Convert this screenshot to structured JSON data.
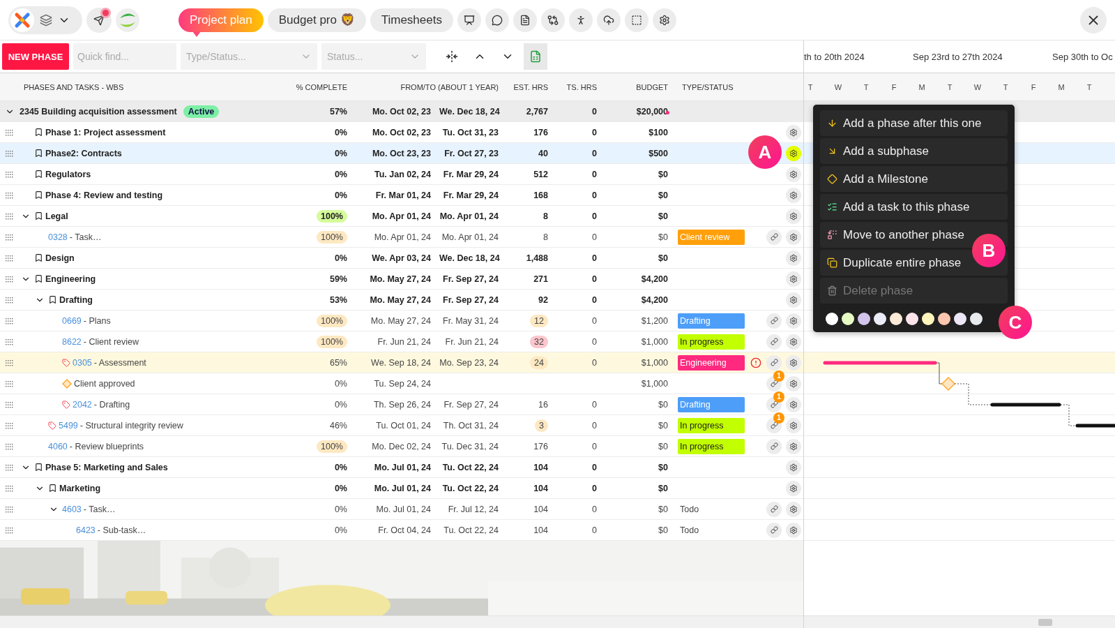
{
  "topbar": {
    "tabs": [
      {
        "label": "Project plan",
        "selected": true
      },
      {
        "label": "Budget pro 🦁",
        "selected": false
      },
      {
        "label": "Timesheets",
        "selected": false
      }
    ],
    "tools": [
      {
        "kind": "presentation"
      },
      {
        "kind": "chat"
      },
      {
        "kind": "file"
      },
      {
        "kind": "compare"
      },
      {
        "kind": "accessibility"
      },
      {
        "kind": "cloud"
      },
      {
        "kind": "select"
      },
      {
        "kind": "settings"
      }
    ],
    "notification": true
  },
  "toolbar": {
    "new_button": "NEW PHASE",
    "search": {
      "placeholder": "Quick find..."
    },
    "type_filter": {
      "placeholder": "Type/Status..."
    },
    "status_filter": {
      "placeholder": "Status..."
    }
  },
  "table": {
    "columns": [
      "PHASES AND TASKS - WBS",
      "% COMPLETE",
      "FROM/TO (ABOUT 1 YEAR)",
      "EST. HRS",
      "TS. HRS",
      "BUDGET",
      "TYPE/STATUS"
    ],
    "rows": [
      {
        "kind": "project",
        "name": "2345 Building acquisition assessment",
        "badge": "Active",
        "expanded": true,
        "selected": false,
        "highlighted": false,
        "percent": "57%",
        "from": "Mo. Oct 02, 23",
        "to": "We. Dec 18, 24",
        "est": "2,767",
        "ts": "0",
        "budget": "$20,000",
        "budget_flag": true,
        "children": [
          {
            "kind": "phase",
            "name": "Phase 1: Project assessment",
            "selected": false,
            "highlighted": false,
            "percent": "0%",
            "from": "Mo. Oct 02, 23",
            "to": "Tu. Oct 31, 23",
            "est": "176",
            "ts": "0",
            "budget": "$100",
            "gear": true,
            "gear_active": false
          },
          {
            "kind": "phase",
            "name": "Phase2: Contracts",
            "selected": true,
            "highlighted": false,
            "percent": "0%",
            "from": "Mo. Oct 23, 23",
            "to": "Fr. Oct 27, 23",
            "est": "40",
            "ts": "0",
            "budget": "$500",
            "gear": true,
            "gear_active": true
          },
          {
            "kind": "phase",
            "name": "Regulators",
            "selected": false,
            "highlighted": false,
            "percent": "0%",
            "from": "Tu. Jan 02, 24",
            "to": "Fr. Mar 29, 24",
            "est": "512",
            "ts": "0",
            "budget": "$0",
            "gear": true,
            "gear_active": false
          },
          {
            "kind": "phase",
            "name": "Phase 4: Review and testing",
            "selected": false,
            "highlighted": false,
            "percent": "0%",
            "from": "Fr. Mar 01, 24",
            "to": "Fr. Mar 29, 24",
            "est": "168",
            "ts": "0",
            "budget": "$0",
            "gear": true,
            "gear_active": false
          },
          {
            "kind": "phase",
            "name": "Legal",
            "expanded": true,
            "selected": false,
            "highlighted": false,
            "percent": "100%",
            "percent_highlight": true,
            "from": "Mo. Apr 01, 24",
            "to": "Mo. Apr 01, 24",
            "est": "8",
            "ts": "0",
            "budget": "$0",
            "gear": true,
            "gear_active": false,
            "children": [
              {
                "kind": "task",
                "code": "0328",
                "name": "- Task…",
                "selected": false,
                "highlighted": false,
                "percent": "100%",
                "percent_highlight": true,
                "from": "Mo. Apr 01, 24",
                "to": "Mo. Apr 01, 24",
                "est": "8",
                "ts": "0",
                "budget": "$0",
                "status": {
                  "label": "Client review",
                  "color": "#ff9f0a"
                },
                "link": true,
                "gear": true,
                "gear_active": false
              }
            ]
          },
          {
            "kind": "phase",
            "name": "Design",
            "selected": false,
            "highlighted": false,
            "percent": "0%",
            "from": "We. Apr 03, 24",
            "to": "We. Dec 18, 24",
            "est": "1,488",
            "ts": "0",
            "budget": "$0",
            "gear": true,
            "gear_active": false
          },
          {
            "kind": "phase",
            "name": "Engineering",
            "expanded": true,
            "selected": false,
            "highlighted": false,
            "percent": "59%",
            "from": "Mo. May 27, 24",
            "to": "Fr. Sep 27, 24",
            "est": "271",
            "ts": "0",
            "budget": "$4,200",
            "gear": true,
            "gear_active": false,
            "children": [
              {
                "kind": "phase",
                "name": "Drafting",
                "expanded": true,
                "selected": false,
                "highlighted": false,
                "percent": "53%",
                "from": "Mo. May 27, 24",
                "to": "Fr. Sep 27, 24",
                "est": "92",
                "ts": "0",
                "budget": "$4,200",
                "gear": true,
                "gear_active": false,
                "children": [
                  {
                    "kind": "task",
                    "code": "0669",
                    "name": "- Plans",
                    "selected": false,
                    "highlighted": false,
                    "percent": "100%",
                    "percent_highlight": true,
                    "from": "Mo. May 27, 24",
                    "to": "Fr. May 31, 24",
                    "est": "12",
                    "est_highlight": true,
                    "est_over": false,
                    "ts": "0",
                    "budget": "$1,200",
                    "status": {
                      "label": "Drafting",
                      "color": "#4d9ef8"
                    },
                    "link": true,
                    "gear": true,
                    "gear_active": false
                  },
                  {
                    "kind": "task",
                    "code": "8622",
                    "name": "- Client review",
                    "selected": false,
                    "highlighted": false,
                    "percent": "100%",
                    "percent_highlight": true,
                    "from": "Fr. Jun 21, 24",
                    "to": "Fr. Jun 21, 24",
                    "est": "32",
                    "est_highlight": true,
                    "est_over": true,
                    "ts": "0",
                    "budget": "$1,000",
                    "status": {
                      "label": "In progress",
                      "color": "#c2ff00"
                    },
                    "link": true,
                    "gear": true,
                    "gear_active": false
                  },
                  {
                    "kind": "task",
                    "tag": true,
                    "code": "0305",
                    "name": "- Assessment",
                    "selected": false,
                    "highlighted": true,
                    "percent": "65%",
                    "from": "We. Sep 18, 24",
                    "to": "Mo. Sep 23, 24",
                    "est": "24",
                    "est_highlight": true,
                    "est_over": false,
                    "ts": "0",
                    "budget": "$1,000",
                    "status": {
                      "label": "Engineering",
                      "color": "#ff2a7f"
                    },
                    "warning": true,
                    "link": true,
                    "gear": true,
                    "gear_active": false
                  },
                  {
                    "kind": "milestone",
                    "name": "Client approved",
                    "selected": false,
                    "highlighted": false,
                    "percent": "0%",
                    "from": "Tu. Sep 24, 24",
                    "budget": "$1,000",
                    "link": true,
                    "link_count": "1",
                    "gear": true,
                    "gear_active": false
                  },
                  {
                    "kind": "task",
                    "tag": true,
                    "code": "2042",
                    "name": "- Drafting",
                    "selected": false,
                    "highlighted": false,
                    "percent": "0%",
                    "from": "Th. Sep 26, 24",
                    "to": "Fr. Sep 27, 24",
                    "est": "16",
                    "ts": "0",
                    "budget": "$0",
                    "status": {
                      "label": "Drafting",
                      "color": "#4d9ef8"
                    },
                    "link": true,
                    "link_count": "1",
                    "gear": true,
                    "gear_active": false
                  }
                ]
              },
              {
                "kind": "task",
                "tag": true,
                "code": "5499",
                "name": "- Structural integrity review",
                "selected": false,
                "highlighted": false,
                "percent": "46%",
                "from": "Tu. Oct 01, 24",
                "to": "Th. Oct 31, 24",
                "est": "3",
                "est_highlight": true,
                "est_over": false,
                "ts": "0",
                "budget": "$0",
                "status": {
                  "label": "In progress",
                  "color": "#c2ff00"
                },
                "link": true,
                "link_count": "1",
                "gear": true,
                "gear_active": false
              },
              {
                "kind": "task",
                "code": "4060",
                "name": "- Review blueprints",
                "selected": false,
                "highlighted": false,
                "percent": "100%",
                "percent_highlight": true,
                "from": "Mo. Dec 02, 24",
                "to": "Tu. Dec 31, 24",
                "est": "176",
                "ts": "0",
                "budget": "$0",
                "status": {
                  "label": "In progress",
                  "color": "#c2ff00"
                },
                "link": true,
                "gear": true,
                "gear_active": false
              }
            ]
          },
          {
            "kind": "phase",
            "name": "Phase 5: Marketing and Sales",
            "expanded": true,
            "selected": false,
            "highlighted": false,
            "percent": "0%",
            "from": "Mo. Jul 01, 24",
            "to": "Tu. Oct 22, 24",
            "est": "104",
            "ts": "0",
            "budget": "$0",
            "gear": true,
            "gear_active": false,
            "children": [
              {
                "kind": "phase",
                "name": "Marketing",
                "expanded": true,
                "selected": false,
                "highlighted": false,
                "percent": "0%",
                "from": "Mo. Jul 01, 24",
                "to": "Tu. Oct 22, 24",
                "est": "104",
                "ts": "0",
                "budget": "$0",
                "gear": true,
                "gear_active": false,
                "children": [
                  {
                    "kind": "task",
                    "code": "4603",
                    "name": "- Task…",
                    "expanded": true,
                    "selected": false,
                    "highlighted": false,
                    "percent": "0%",
                    "from": "Mo. Jul 01, 24",
                    "to": "Fr. Jul 12, 24",
                    "est": "104",
                    "ts": "0",
                    "budget": "$0",
                    "status_text": "Todo",
                    "link": true,
                    "gear": true,
                    "gear_active": false,
                    "children": [
                      {
                        "kind": "task",
                        "code": "6423",
                        "name": "- Sub-task…",
                        "selected": false,
                        "highlighted": false,
                        "percent": "0%",
                        "from": "Fr. Oct 04, 24",
                        "to": "Tu. Oct 22, 24",
                        "est": "104",
                        "ts": "0",
                        "budget": "$0",
                        "status_text": "Todo",
                        "link": true,
                        "gear": true,
                        "gear_active": false
                      }
                    ]
                  }
                ]
              }
            ]
          }
        ]
      }
    ]
  },
  "gantt": {
    "weeks": [
      "th to 20th 2024",
      "Sep 23rd to 27th 2024",
      "Sep 30th to Oc"
    ],
    "days": [
      "T",
      "W",
      "T",
      "F",
      "M",
      "T",
      "W",
      "T",
      "F",
      "M",
      "T"
    ]
  },
  "menu": {
    "items": [
      {
        "kind": "after",
        "label": "Add a phase after this one",
        "disabled": false
      },
      {
        "kind": "subphase",
        "label": "Add a subphase",
        "disabled": false
      },
      {
        "kind": "milestone",
        "label": "Add a Milestone",
        "disabled": false
      },
      {
        "kind": "task",
        "label": "Add a task to this phase",
        "disabled": false
      },
      {
        "kind": "move",
        "label": "Move to another phase",
        "disabled": false
      },
      {
        "kind": "duplicate",
        "label": "Duplicate entire phase",
        "disabled": false
      },
      {
        "kind": "delete",
        "label": "Delete phase",
        "disabled": true
      }
    ],
    "swatches": [
      {
        "color": "#ffffff"
      },
      {
        "color": "#e6fbc4"
      },
      {
        "color": "#d2c4ec"
      },
      {
        "color": "#ecebf8"
      },
      {
        "color": "#fdebd8"
      },
      {
        "color": "#fde4ea"
      },
      {
        "color": "#fdf5bc"
      },
      {
        "color": "#fcc6b0"
      },
      {
        "color": "#ece6f6"
      },
      {
        "color": "#e8ebee"
      }
    ]
  },
  "callouts": [
    "A",
    "B",
    "C"
  ]
}
